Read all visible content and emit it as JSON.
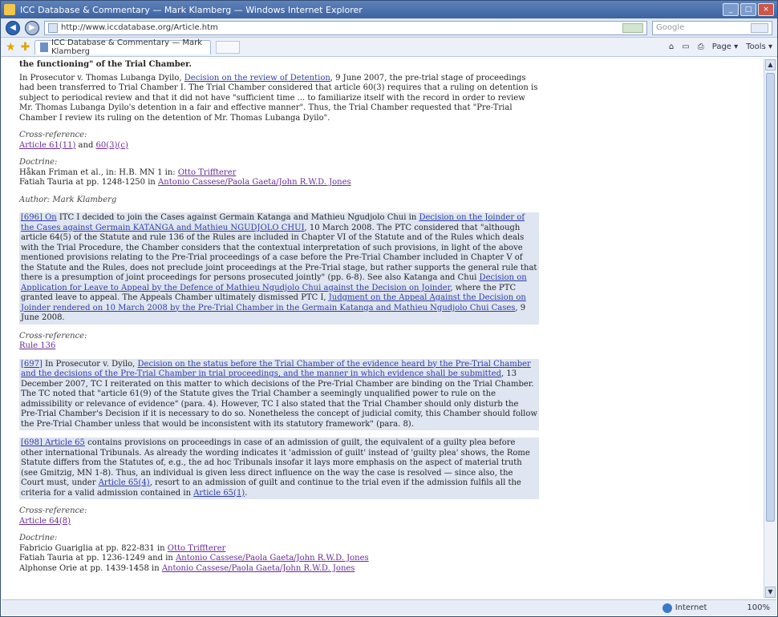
{
  "window": {
    "title": "ICC Database & Commentary — Mark Klamberg — Windows Internet Explorer"
  },
  "address": {
    "url": "http://www.iccdatabase.org/Article.htm",
    "search_placeholder": "Google"
  },
  "tab": {
    "title": "ICC Database & Commentary — Mark Klamberg"
  },
  "toolbar": {
    "home": "⌂",
    "feeds": "▭",
    "print": "⎙",
    "page": "Page ▾",
    "tools": "Tools ▾"
  },
  "content": {
    "p1_heading": "the functioning\" of the Trial Chamber.",
    "p2_text1": "In Prosecutor v. Thomas Lubanga Dyilo,",
    "p2_link": "Decision on the review of Detention",
    "p2_text2": ", 9 June 2007, the pre-trial stage of proceedings had been transferred to Trial Chamber I. The Trial Chamber considered that article 60(3) requires that a ruling on detention is subject to periodical review and that it did not have \"sufficient time ... to familiarize itself with the record in order to review Mr. Thomas Lubanga Dyilo's detention in a fair and effective manner\". Thus, the Trial Chamber requested that \"Pre-Trial Chamber I review its ruling on the detention of Mr. Thomas Lubanga Dyilo\".",
    "cross1_label": "Cross-reference:",
    "cross1_link1": "Article 61(11)",
    "cross1_and": " and ",
    "cross1_link2": "60(3)(c)",
    "doctrine1_label": "Doctrine:",
    "doctrine1_line1": "Håkan Friman et al., in: H.B. MN 1 in:",
    "doctrine1_line1_link": "Otto Triffterer",
    "doctrine1_line2": "Fatiah Tauria at pp. 1248-1250 in",
    "doctrine1_line2_link": "Antonio Cassese/Paola Gaeta/John R.W.D. Jones",
    "author": "Author: Mark Klamberg",
    "p3_anchor": "[696] On",
    "p3_text1": " ITC I decided to join the Cases against Germain Katanga and Mathieu Ngudjolo Chui in",
    "p3_link1": "Decision on the Joinder of the Cases against Germain KATANGA and Mathieu NGUDJOLO CHUI",
    "p3_text2": ", 10 March 2008. The PTC considered that \"although article 64(5) of the Statute and rule 136 of the Rules are included in Chapter VI of the Statute and of the Rules which deals with the Trial Procedure, the Chamber considers that the contextual interpretation of such provisions, in light of the above mentioned provisions relating to the Pre-Trial proceedings of a case before the Pre-Trial Chamber included in Chapter V of the Statute and the Rules, does not preclude joint proceedings at the Pre-Trial stage, but rather supports the general rule that there is a presumption of joint proceedings for persons prosecuted jointly\" (pp. 6-8). See also Katanga and Chui",
    "p3_link2": "Decision on Application for Leave to Appeal by the Defence of Mathieu Ngudjolo Chui against the Decision on Joinder",
    "p3_text3": ", where the PTC granted leave to appeal. The Appeals Chamber ultimately dismissed PTC I,",
    "p3_link3": "Judgment on the Appeal Against the Decision on Joinder rendered on 10 March 2008 by the Pre-Trial Chamber in the Germain Katanga and Mathieu Ngudjolo Chui Cases",
    "p3_text4": ", 9 June 2008.",
    "cross2_label": "Cross-reference:",
    "cross2_link": "Rule 136",
    "p4_anchor": "[697]",
    "p4_text1": " In Prosecutor v. Dyilo,",
    "p4_link1": "Decision on the status before the Trial Chamber of the evidence heard by the Pre-Trial Chamber and the decisions of the Pre-Trial Chamber in trial proceedings, and the manner in which evidence shall be submitted",
    "p4_text2": ", 13 December 2007, TC I reiterated on this matter to which decisions of the Pre-Trial Chamber are binding on the Trial Chamber. The TC noted that \"article 61(9) of the Statute gives the Trial Chamber a seemingly unqualified power to rule on the admissibility or relevance of evidence\" (para. 4). However, TC I also stated that the Trial Chamber should only disturb the Pre-Trial Chamber's Decision if it is necessary to do so. Nonetheless the concept of judicial comity, this Chamber should follow the Pre-Trial Chamber unless that would be inconsistent with its statutory framework\" (para. 8).",
    "p5_anchor": "[698] Article 65",
    "p5_text1": " contains provisions on proceedings in case of an admission of guilt, the equivalent of a guilty plea before other international Tribunals. As already the wording indicates it 'admission of guilt' instead of 'guilty plea' shows, the Rome Statute differs from the Statutes of, e.g., the ad hoc Tribunals insofar it lays more emphasis on the aspect of material truth (see Gmitzig, MN 1-8). Thus, an individual is given less direct influence on the way the case is resolved — since also, the Court must, under",
    "p5_link1": "Article 65(4)",
    "p5_text2": ", resort to an admission of guilt and continue to the trial even if the admission fulfils all the criteria for a valid admission contained in",
    "p5_link2": "Article 65(1)",
    "p5_text3": ".",
    "cross3_label": "Cross-reference:",
    "cross3_link": "Article 64(8)",
    "doctrine2_label": "Doctrine:",
    "doctrine2_line1": "Fabricio Guariglia at pp. 822-831 in",
    "doctrine2_line1_link": "Otto Triffterer",
    "doctrine2_line2": "Fatiah Tauria at pp. 1236-1249 and in",
    "doctrine2_line2_link": "Antonio Cassese/Paola Gaeta/John R.W.D. Jones",
    "doctrine2_line3": "Alphonse Orie at pp. 1439-1458 in",
    "doctrine2_line3_link": "Antonio Cassese/Paola Gaeta/John R.W.D. Jones"
  },
  "status": {
    "zone": "Internet",
    "zoom": "100%"
  },
  "colors": {
    "link": "#2c3ca5",
    "visited": "#6a2a9a",
    "chrome": "#dfe8f5"
  }
}
